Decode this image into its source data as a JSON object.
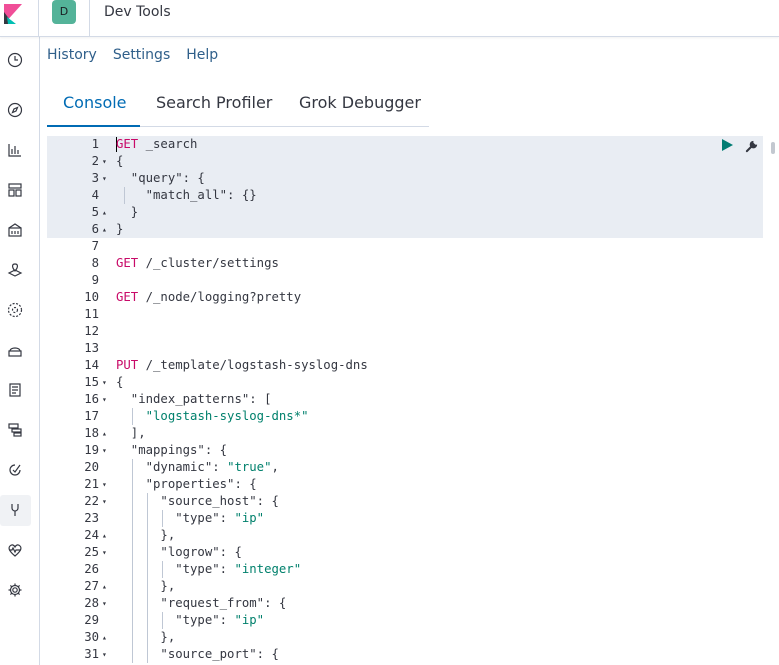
{
  "header": {
    "space_initial": "D",
    "app_title": "Dev Tools"
  },
  "sidenav": {
    "items": [
      {
        "icon": "clock-icon"
      },
      {
        "icon": "compass-icon"
      },
      {
        "icon": "visualize-icon"
      },
      {
        "icon": "dashboard-icon"
      },
      {
        "icon": "canvas-icon"
      },
      {
        "icon": "maps-icon"
      },
      {
        "icon": "ml-icon"
      },
      {
        "icon": "infrastructure-icon"
      },
      {
        "icon": "logs-icon"
      },
      {
        "icon": "apm-icon"
      },
      {
        "icon": "uptime-icon"
      },
      {
        "icon": "dev-tools-icon"
      },
      {
        "icon": "monitoring-icon"
      },
      {
        "icon": "management-gear-icon"
      }
    ]
  },
  "topmenu": {
    "history": "History",
    "settings": "Settings",
    "help": "Help"
  },
  "tabs": {
    "console": "Console",
    "search_profiler": "Search Profiler",
    "grok_debugger": "Grok Debugger"
  },
  "editor": {
    "lines": [
      {
        "n": "1",
        "fold": "",
        "html": "<span class=\"kw\">GET</span> _search"
      },
      {
        "n": "2",
        "fold": "▾",
        "html": "{"
      },
      {
        "n": "3",
        "fold": "▾",
        "html": "  \"query\": {"
      },
      {
        "n": "4",
        "fold": "",
        "html": "    \"match_all\": {}"
      },
      {
        "n": "5",
        "fold": "▴",
        "html": "  }"
      },
      {
        "n": "6",
        "fold": "▴",
        "html": "}"
      },
      {
        "n": "7",
        "fold": "",
        "html": ""
      },
      {
        "n": "8",
        "fold": "",
        "html": "<span class=\"kw\">GET</span> /_cluster/settings"
      },
      {
        "n": "9",
        "fold": "",
        "html": ""
      },
      {
        "n": "10",
        "fold": "",
        "html": "<span class=\"kw\">GET</span> /_node/logging?pretty"
      },
      {
        "n": "11",
        "fold": "",
        "html": ""
      },
      {
        "n": "12",
        "fold": "",
        "html": ""
      },
      {
        "n": "13",
        "fold": "",
        "html": ""
      },
      {
        "n": "14",
        "fold": "",
        "html": "<span class=\"kw\">PUT</span> /_template/logstash-syslog-dns"
      },
      {
        "n": "15",
        "fold": "▾",
        "html": "{"
      },
      {
        "n": "16",
        "fold": "▾",
        "html": "  \"index_patterns\": ["
      },
      {
        "n": "17",
        "fold": "",
        "html": "    <span class=\"str\">\"logstash-syslog-dns*\"</span>"
      },
      {
        "n": "18",
        "fold": "▴",
        "html": "  ],"
      },
      {
        "n": "19",
        "fold": "▾",
        "html": "  \"mappings\": {"
      },
      {
        "n": "20",
        "fold": "",
        "html": "    \"dynamic\": <span class=\"str\">\"true\"</span>,"
      },
      {
        "n": "21",
        "fold": "▾",
        "html": "    \"properties\": {"
      },
      {
        "n": "22",
        "fold": "▾",
        "html": "      \"source_host\": {"
      },
      {
        "n": "23",
        "fold": "",
        "html": "        \"type\": <span class=\"str\">\"ip\"</span>"
      },
      {
        "n": "24",
        "fold": "▴",
        "html": "      },"
      },
      {
        "n": "25",
        "fold": "▾",
        "html": "      \"logrow\": {"
      },
      {
        "n": "26",
        "fold": "",
        "html": "        \"type\": <span class=\"str\">\"integer\"</span>"
      },
      {
        "n": "27",
        "fold": "▴",
        "html": "      },"
      },
      {
        "n": "28",
        "fold": "▾",
        "html": "      \"request_from\": {"
      },
      {
        "n": "29",
        "fold": "",
        "html": "        \"type\": <span class=\"str\">\"ip\"</span>"
      },
      {
        "n": "30",
        "fold": "▴",
        "html": "      },"
      },
      {
        "n": "31",
        "fold": "▾",
        "html": "      \"source_port\": {"
      }
    ]
  }
}
